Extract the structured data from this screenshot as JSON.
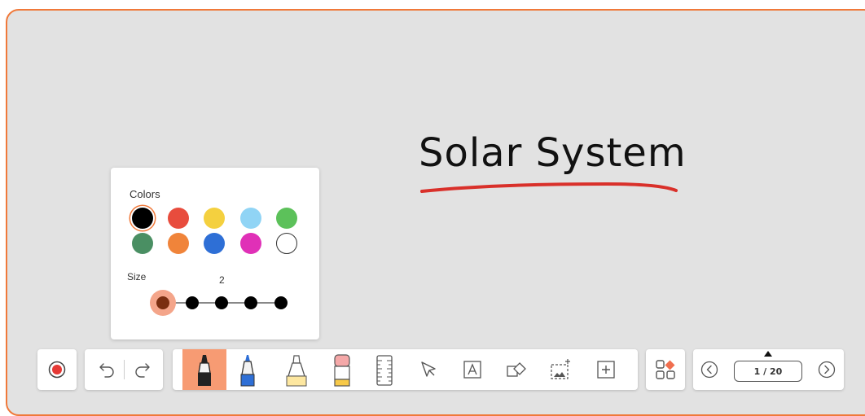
{
  "canvas": {
    "title": "Solar System"
  },
  "color_panel": {
    "colors_label": "Colors",
    "size_label": "Size",
    "size_value": "2",
    "colors": [
      "#000000",
      "#e84c3d",
      "#f4d03f",
      "#90d4f5",
      "#5cc15a",
      "#4a8f63",
      "#f0843a",
      "#2e6fd6",
      "#e030b7",
      "#ffffff"
    ],
    "selected_color": "#000000",
    "sizes": [
      1,
      2,
      3,
      4,
      5
    ],
    "selected_size": 1
  },
  "toolbar": {
    "tools": [
      "marker",
      "pen",
      "highlighter",
      "eraser",
      "ruler",
      "select",
      "text",
      "shapes",
      "screenshot",
      "insert"
    ],
    "active_tool": "marker",
    "accent_color": "#f79b73"
  },
  "pager": {
    "label": "1 / 20"
  }
}
